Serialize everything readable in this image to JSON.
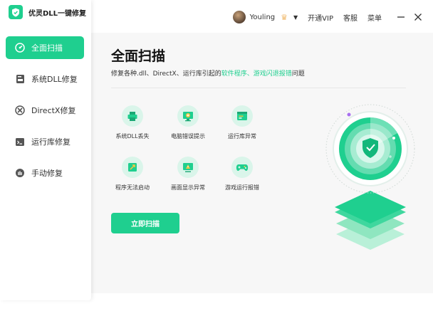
{
  "app": {
    "name": "优灵DLL一键修复"
  },
  "sidebar": {
    "items": [
      {
        "label": "全面扫描",
        "icon": "gauge-icon",
        "active": true
      },
      {
        "label": "系统DLL修复",
        "icon": "dll-file-icon",
        "active": false
      },
      {
        "label": "DirectX修复",
        "icon": "directx-icon",
        "active": false
      },
      {
        "label": "运行库修复",
        "icon": "terminal-icon",
        "active": false
      },
      {
        "label": "手动修复",
        "icon": "hand-icon",
        "active": false
      }
    ]
  },
  "header": {
    "username": "Youling",
    "vip_link": "开通VIP",
    "service_link": "客服",
    "menu_link": "菜单"
  },
  "main": {
    "title": "全面扫描",
    "subtitle_prefix": "修复各种.dll、DirectX、运行库引起的",
    "subtitle_highlight": "软件程序、游戏闪退报错",
    "subtitle_suffix": "问题",
    "features": [
      {
        "label": "系统DLL丢失",
        "icon": "printer-icon"
      },
      {
        "label": "电脑错误提示",
        "icon": "monitor-error-icon"
      },
      {
        "label": "运行库异常",
        "icon": "window-icon"
      },
      {
        "label": "程序无法启动",
        "icon": "rocket-icon"
      },
      {
        "label": "画面显示异常",
        "icon": "monitor-warning-icon"
      },
      {
        "label": "游戏运行报错",
        "icon": "gamepad-icon"
      }
    ],
    "scan_button": "立即扫描"
  },
  "colors": {
    "accent": "#1fcf8f",
    "accent_light": "#daf5ea",
    "background": "#f7f7f7"
  }
}
